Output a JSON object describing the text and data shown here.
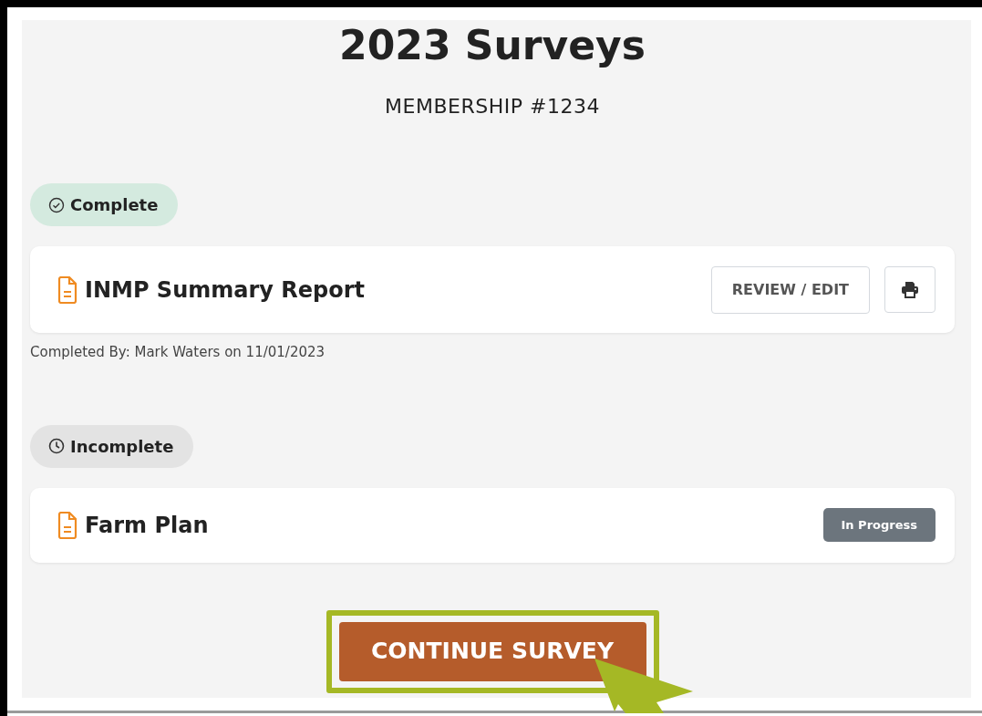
{
  "page": {
    "title": "2023 Surveys",
    "subtitle": "MEMBERSHIP #1234"
  },
  "groups": [
    {
      "kind": "complete",
      "label": "Complete",
      "surveys": [
        {
          "name": "INMP Summary Report",
          "actions": [
            {
              "kind": "text",
              "label": "REVIEW / EDIT"
            },
            {
              "kind": "print"
            }
          ],
          "note": "Completed By: Mark Waters on 11/01/2023"
        }
      ]
    },
    {
      "kind": "incomplete",
      "label": "Incomplete",
      "surveys": [
        {
          "name": "Farm Plan",
          "badge": "In Progress"
        }
      ]
    }
  ],
  "primary_button": {
    "label": "CONTINUE SURVEY",
    "highlighted": true
  }
}
